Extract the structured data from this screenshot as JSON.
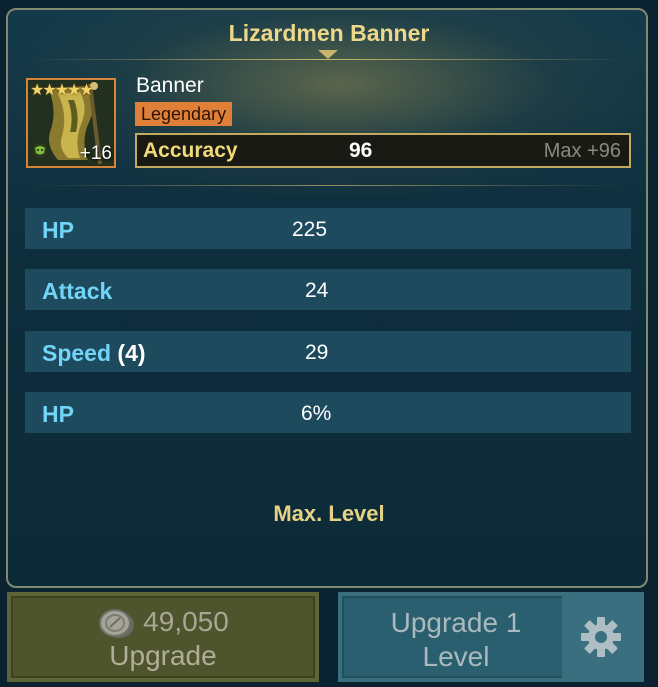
{
  "item": {
    "title": "Lizardmen Banner",
    "type": "Banner",
    "rarity": "Legendary",
    "stars": "★★★★★",
    "level": "+16",
    "main_stat": {
      "name": "Accuracy",
      "value": "96",
      "max": "Max +96"
    }
  },
  "substats": [
    {
      "name": "HP",
      "roll": "",
      "value": "225"
    },
    {
      "name": "Attack",
      "roll": "",
      "value": "24"
    },
    {
      "name": "Speed",
      "roll": "(4)",
      "value": "29"
    },
    {
      "name": "HP",
      "roll": "",
      "value": "6%"
    }
  ],
  "status_text": "Max. Level",
  "buttons": {
    "upgrade": {
      "cost": "49,050",
      "label": "Upgrade"
    },
    "upgrade_level": {
      "label_line1": "Upgrade 1",
      "label_line2": "Level"
    }
  },
  "icons": {
    "coin": "silver-coin-icon",
    "gear": "gear-icon",
    "set": "lizardman-set-icon"
  },
  "colors": {
    "title": "#ecd88a",
    "rarity": "#e07f38",
    "substat_name": "#72d4f6",
    "main_stat_name": "#f1d878"
  }
}
